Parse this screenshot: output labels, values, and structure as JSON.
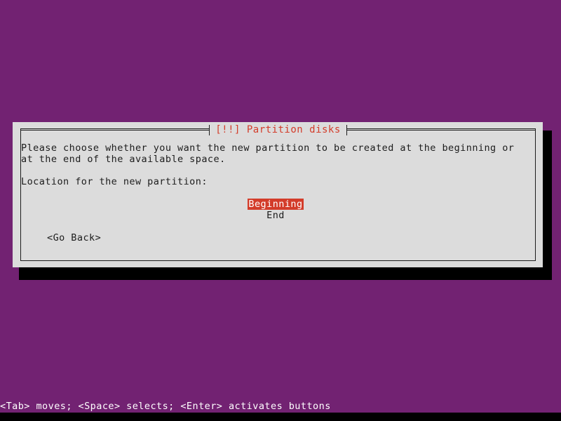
{
  "screen": {
    "background_color": "#722272",
    "shadow_color": "#000000",
    "bottom_strip_color": "#000000"
  },
  "dialog": {
    "title": "[!!] Partition disks",
    "title_color": "#d33c2a",
    "background_color": "#dcdcdc",
    "border_color": "#1c1c1c",
    "paragraph": "Please choose whether you want the new partition to be created at the beginning or at the end of the available space.",
    "prompt_label": "Location for the new partition:",
    "options": [
      {
        "label": "Beginning",
        "selected": true
      },
      {
        "label": "End",
        "selected": false
      }
    ],
    "selection_highlight_color": "#d33c2a",
    "selection_text_color": "#ffffff",
    "buttons": [
      {
        "label": "<Go Back>"
      }
    ]
  },
  "status_bar": {
    "text": "<Tab> moves; <Space> selects; <Enter> activates buttons",
    "text_color": "#ffffff"
  }
}
